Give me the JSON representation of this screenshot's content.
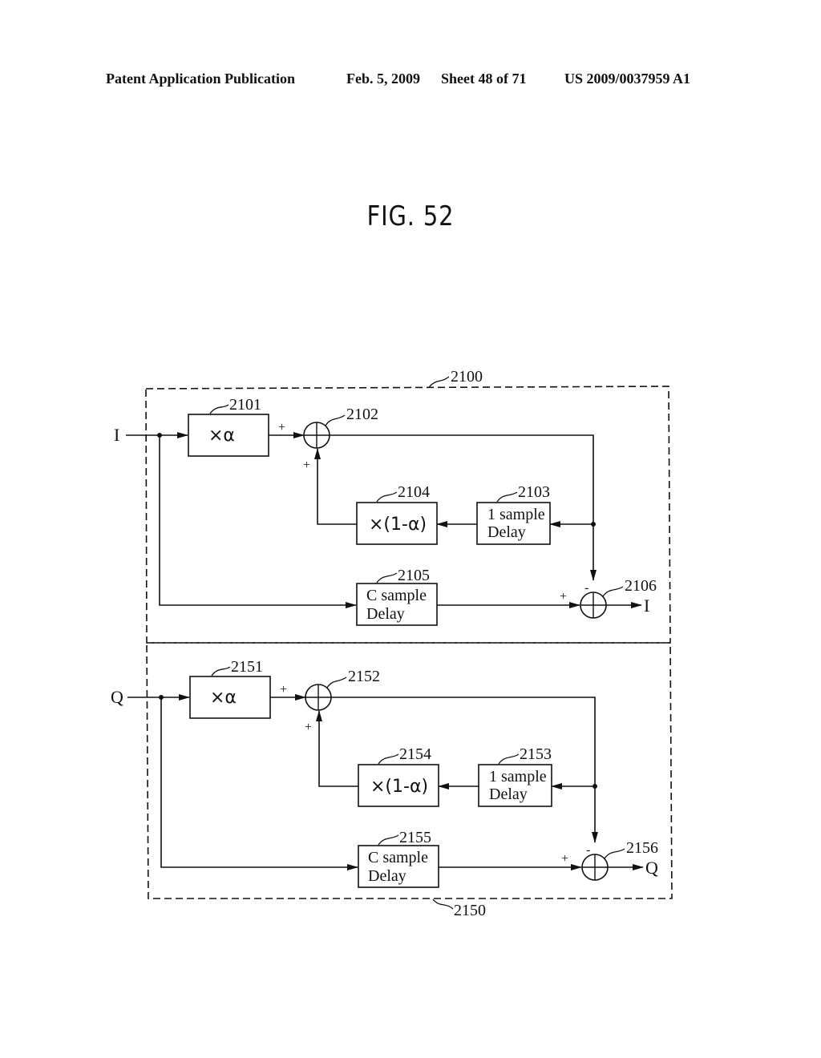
{
  "header": {
    "publication": "Patent Application Publication",
    "date": "Feb. 5, 2009",
    "sheet": "Sheet 48 of 71",
    "number": "US 2009/0037959 A1"
  },
  "figure": {
    "title": "FIG. 52"
  },
  "diagram": {
    "upper": {
      "ref": "2100",
      "input": "I",
      "output": "I",
      "mult_alpha": {
        "ref": "2101",
        "label": "×α"
      },
      "adder1": {
        "ref": "2102",
        "sign_a": "+",
        "sign_b": "+"
      },
      "delay1": {
        "ref": "2103",
        "line1": "1 sample",
        "line2": "Delay"
      },
      "mult_1ma": {
        "ref": "2104",
        "label": "×(1-α)"
      },
      "delayC": {
        "ref": "2105",
        "line1": "C sample",
        "line2": "Delay"
      },
      "adder2": {
        "ref": "2106",
        "sign_minus": "-",
        "sign_plus": "+"
      }
    },
    "lower": {
      "ref": "2150",
      "input": "Q",
      "output": "Q",
      "mult_alpha": {
        "ref": "2151",
        "label": "×α"
      },
      "adder1": {
        "ref": "2152",
        "sign_a": "+",
        "sign_b": "+"
      },
      "delay1": {
        "ref": "2153",
        "line1": "1 sample",
        "line2": "Delay"
      },
      "mult_1ma": {
        "ref": "2154",
        "label": "×(1-α)"
      },
      "delayC": {
        "ref": "2155",
        "line1": "C sample",
        "line2": "Delay"
      },
      "adder2": {
        "ref": "2156",
        "sign_minus": "-",
        "sign_plus": "+"
      }
    }
  }
}
